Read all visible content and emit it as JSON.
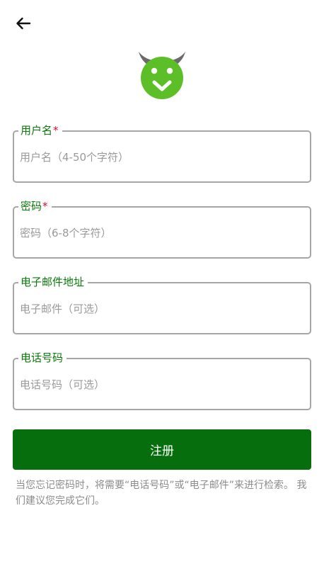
{
  "header": {
    "back_icon": "arrow-left-icon",
    "logo_icon": "happymod-logo-icon"
  },
  "colors": {
    "accent_green": "#066e0c",
    "label_green": "#0a7a0a",
    "logo_green": "#5cbf27",
    "required_red": "#c8102e",
    "border_gray": "#a6a6a6"
  },
  "form": {
    "username": {
      "label": "用户名",
      "required_mark": "*",
      "placeholder": "用户名（4-50个字符）",
      "value": ""
    },
    "password": {
      "label": "密码",
      "required_mark": "*",
      "placeholder": "密码（6-8个字符）",
      "value": ""
    },
    "email": {
      "label": "电子邮件地址",
      "placeholder": "电子邮件（可选）",
      "value": ""
    },
    "phone": {
      "label": "电话号码",
      "placeholder": "电话号码（可选）",
      "value": ""
    },
    "submit_label": "注册"
  },
  "notice": "当您忘记密码时，将需要“电话号码”或“电子邮件”来进行检索。 我们建议您完成它们。"
}
